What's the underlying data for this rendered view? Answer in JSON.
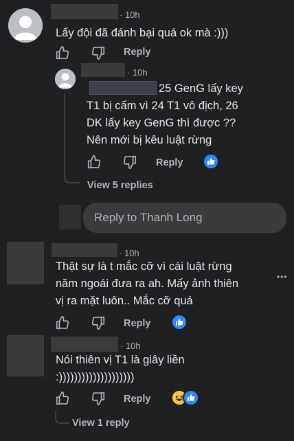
{
  "comments": [
    {
      "time": "10h",
      "text": "Lấy đội đã đánh bại quá ok mà :)))",
      "like_label": "Reply"
    },
    {
      "time": "10h",
      "text_lines": [
        "25 GenG lấy key",
        "T1 bị cấm vì 24 T1 vô địch, 26",
        "DK lấy key GenG thì được ??",
        "Nên mới bị kêu luật rừng"
      ],
      "reply_label": "Reply"
    },
    {
      "time": "10h",
      "text_lines": [
        "Thật sự là t mắc cỡ vì cái luật rừng",
        "năm ngoái đưa ra ah. Mấy ảnh thiên",
        "vị ra mặt luôn.. Mắc cỡ quá"
      ],
      "reply_label": "Reply",
      "more": "•••"
    },
    {
      "time": "10h",
      "text_lines": [
        "Nói thiên vị T1 là giây liền",
        ":))))))))))))))))))))"
      ],
      "reply_label": "Reply"
    }
  ],
  "view_replies_1": "View 5 replies",
  "view_replies_2": "View 1 reply",
  "reply_input": {
    "placeholder": "Reply to Thanh Long"
  },
  "colors": {
    "background": "#1f2021",
    "text": "#e4e6eb",
    "muted": "#b0b3b8",
    "accent": "#2d88ff"
  },
  "icons": [
    "thumb-up-icon",
    "thumb-down-icon",
    "like-reaction-icon",
    "haha-reaction-icon",
    "more-options-icon",
    "avatar-icon"
  ]
}
